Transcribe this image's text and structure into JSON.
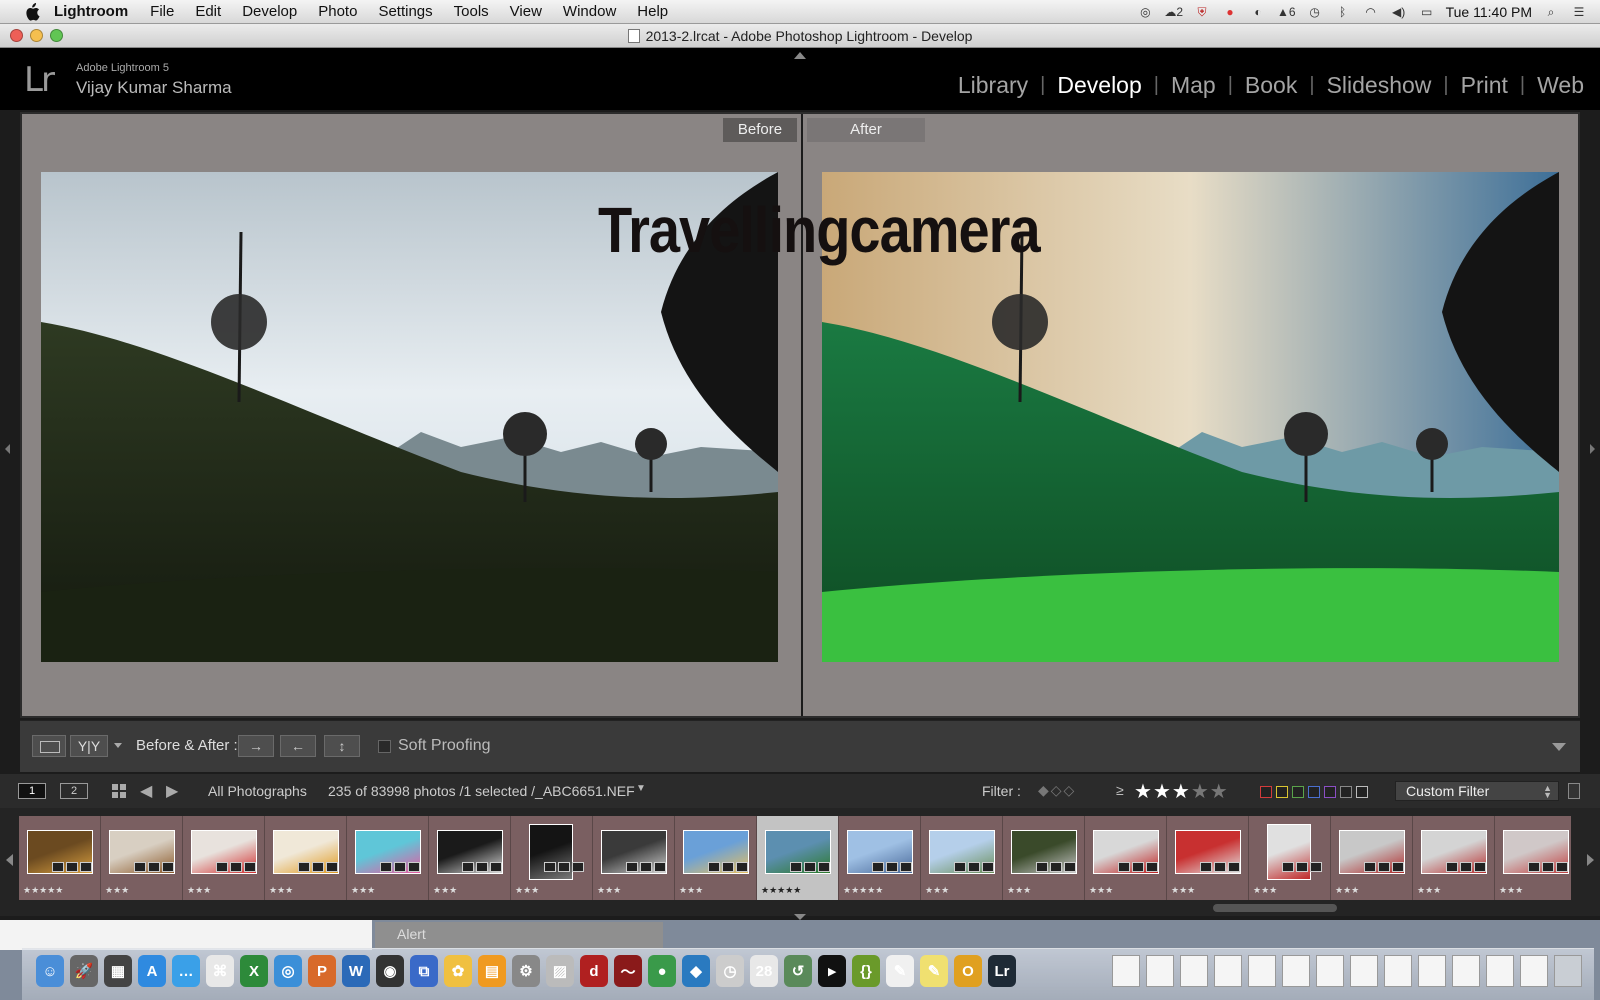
{
  "menubar": {
    "app_name": "Lightroom",
    "items": [
      "File",
      "Edit",
      "Develop",
      "Photo",
      "Settings",
      "Tools",
      "View",
      "Window",
      "Help"
    ],
    "tray_badge_count": "2",
    "tray_adobe_count": "6",
    "clock": "Tue 11:40 PM"
  },
  "window": {
    "title": "2013-2.lrcat - Adobe Photoshop Lightroom - Develop",
    "traffic_colors": [
      "#ee5f57",
      "#f5bf4f",
      "#61c554"
    ]
  },
  "identity": {
    "logo": "Lr",
    "product": "Adobe Lightroom 5",
    "owner": "Vijay Kumar Sharma"
  },
  "modules": {
    "items": [
      "Library",
      "Develop",
      "Map",
      "Book",
      "Slideshow",
      "Print",
      "Web"
    ],
    "active": "Develop"
  },
  "view": {
    "before_label": "Before",
    "after_label": "After",
    "watermark": "Travellingcamera"
  },
  "toolbar": {
    "yy_label": "Y|Y",
    "before_after_label": "Before & After :",
    "soft_proofing_label": "Soft Proofing",
    "soft_proofing_checked": false,
    "swap_icons": [
      "arrow-right-icon",
      "arrow-left-icon",
      "swap-vertical-icon"
    ]
  },
  "filmstrip_header": {
    "monitor_1": "1",
    "monitor_2": "2",
    "source": "All Photographs",
    "count": "235 of 83998 photos /1 selected /_ABC6651.NEF",
    "filter_label": "Filter :",
    "rating_op": "≥",
    "rating_filter": 3,
    "rating_max": 5,
    "color_labels": [
      "#d23b3b",
      "#d9c431",
      "#5aa34a",
      "#4b6fcf",
      "#8b4fc4",
      "#888888",
      "#bbbbbb"
    ],
    "custom_filter": "Custom Filter"
  },
  "filmstrip": {
    "selected_index": 9,
    "thumbs": [
      {
        "stars": "★★★★★",
        "color": "#6b4a20",
        "color2": "#d9a040",
        "portrait": false
      },
      {
        "stars": "★★★",
        "color": "#d8cfc2",
        "color2": "#8c5a2a",
        "portrait": false
      },
      {
        "stars": "★★★",
        "color": "#e8e2dd",
        "color2": "#d23030",
        "portrait": false
      },
      {
        "stars": "★★★",
        "color": "#f0e8d8",
        "color2": "#e09a20",
        "portrait": false
      },
      {
        "stars": "★★★",
        "color": "#5fc6d8",
        "color2": "#e85aa0",
        "portrait": false
      },
      {
        "stars": "★★★",
        "color": "#1a1a1a",
        "color2": "#d8d8d8",
        "portrait": false
      },
      {
        "stars": "★★★",
        "color": "#141414",
        "color2": "#7a7a7a",
        "portrait": true
      },
      {
        "stars": "★★★",
        "color": "#3a3a3a",
        "color2": "#cfcfcf",
        "portrait": false
      },
      {
        "stars": "★★★",
        "color": "#6aa0d8",
        "color2": "#e7c060",
        "portrait": false
      },
      {
        "stars": "★★★★★",
        "color": "#5c8fb0",
        "color2": "#2c7a2c",
        "portrait": false
      },
      {
        "stars": "★★★★★",
        "color": "#9fc0e4",
        "color2": "#4a6a9a",
        "portrait": false
      },
      {
        "stars": "★★★",
        "color": "#b5cfea",
        "color2": "#6a8f5a",
        "portrait": false
      },
      {
        "stars": "★★★",
        "color": "#3a4a2a",
        "color2": "#c8c8c8",
        "portrait": false
      },
      {
        "stars": "★★★",
        "color": "#d8d8d8",
        "color2": "#c02020",
        "portrait": false
      },
      {
        "stars": "★★★",
        "color": "#c83030",
        "color2": "#e4e4e4",
        "portrait": false
      },
      {
        "stars": "★★★",
        "color": "#e0e0e0",
        "color2": "#c02828",
        "portrait": true
      },
      {
        "stars": "★★★",
        "color": "#c8c8c8",
        "color2": "#b02a2a",
        "portrait": false
      },
      {
        "stars": "★★★",
        "color": "#d4d4d4",
        "color2": "#b83030",
        "portrait": false
      },
      {
        "stars": "★★★",
        "color": "#d0c8c8",
        "color2": "#c04040",
        "portrait": false
      }
    ]
  },
  "alert": {
    "title": "Alert"
  },
  "dock": {
    "apps": [
      {
        "icon": "finder-icon",
        "color": "#4a8ed8",
        "glyph": "☺"
      },
      {
        "icon": "launchpad-icon",
        "color": "#666",
        "glyph": "🚀"
      },
      {
        "icon": "dashboard-icon",
        "color": "#444",
        "glyph": "▦"
      },
      {
        "icon": "app-store-icon",
        "color": "#2f8ae0",
        "glyph": "A"
      },
      {
        "icon": "messages-icon",
        "color": "#3aa0e8",
        "glyph": "…"
      },
      {
        "icon": "acrobat-icon",
        "color": "#e8e8e8",
        "glyph": "⌘"
      },
      {
        "icon": "excel-icon",
        "color": "#2d8a3a",
        "glyph": "X"
      },
      {
        "icon": "safari-icon",
        "color": "#3b8fd8",
        "glyph": "◎"
      },
      {
        "icon": "powerpoint-icon",
        "color": "#d86a2a",
        "glyph": "P"
      },
      {
        "icon": "word-icon",
        "color": "#2b6ab8",
        "glyph": "W"
      },
      {
        "icon": "airport-icon",
        "color": "#333",
        "glyph": "◉"
      },
      {
        "icon": "migration-icon",
        "color": "#3a6ac8",
        "glyph": "⧉"
      },
      {
        "icon": "photos-icon",
        "color": "#f0c040",
        "glyph": "✿"
      },
      {
        "icon": "ibooks-icon",
        "color": "#f09a20",
        "glyph": "▤"
      },
      {
        "icon": "settings-icon",
        "color": "#888",
        "glyph": "⚙"
      },
      {
        "icon": "preview-icon",
        "color": "#bbb",
        "glyph": "▨"
      },
      {
        "icon": "dictionary-icon",
        "color": "#b02020",
        "glyph": "d"
      },
      {
        "icon": "rss-icon",
        "color": "#8a1a1a",
        "glyph": "〜"
      },
      {
        "icon": "chrome-icon",
        "color": "#3a9a4a",
        "glyph": "●"
      },
      {
        "icon": "network-icon",
        "color": "#2a7ac0",
        "glyph": "◆"
      },
      {
        "icon": "clock-icon",
        "color": "#ccc",
        "glyph": "◷"
      },
      {
        "icon": "calendar-icon",
        "color": "#e8e8e8",
        "glyph": "28"
      },
      {
        "icon": "time-machine-icon",
        "color": "#5a8a5a",
        "glyph": "↺"
      },
      {
        "icon": "terminal-icon",
        "color": "#111",
        "glyph": "▸"
      },
      {
        "icon": "brackets-icon",
        "color": "#6a9a2a",
        "glyph": "{}"
      },
      {
        "icon": "textedit-icon",
        "color": "#f0f0f0",
        "glyph": "✎"
      },
      {
        "icon": "stickies-icon",
        "color": "#f0e070",
        "glyph": "✎"
      },
      {
        "icon": "other-icon",
        "color": "#e0a020",
        "glyph": "O"
      },
      {
        "icon": "lightroom-icon",
        "color": "#1e2a36",
        "glyph": "Lr"
      }
    ]
  }
}
